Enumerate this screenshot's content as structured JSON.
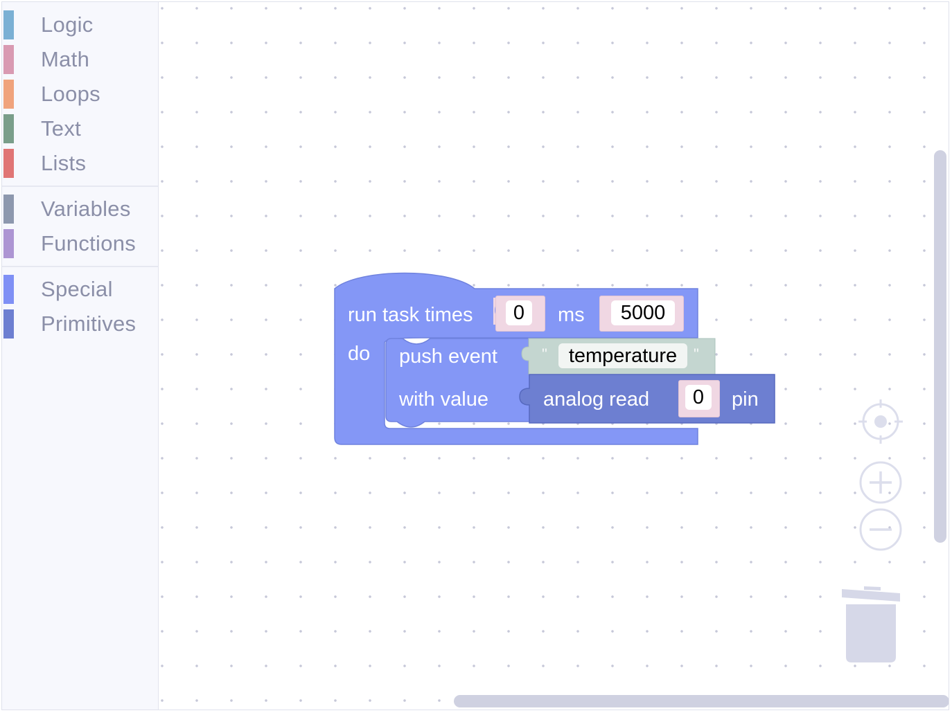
{
  "toolbox": {
    "groups": [
      [
        {
          "label": "Logic",
          "color": "#7bb0d4"
        },
        {
          "label": "Math",
          "color": "#d99ab2"
        },
        {
          "label": "Loops",
          "color": "#f0a37c"
        },
        {
          "label": "Text",
          "color": "#7a9e8a"
        },
        {
          "label": "Lists",
          "color": "#e07575"
        }
      ],
      [
        {
          "label": "Variables",
          "color": "#8d98ae"
        },
        {
          "label": "Functions",
          "color": "#ad95d3"
        }
      ],
      [
        {
          "label": "Special",
          "color": "#7f90f5"
        },
        {
          "label": "Primitives",
          "color": "#6d7fd1"
        }
      ]
    ]
  },
  "block": {
    "run_task_label": "run task times",
    "first_value": "0",
    "ms_label": "ms",
    "second_value": "5000",
    "do_label": "do",
    "push_event_label": "push event",
    "with_value_label": "with value",
    "quote_open": "\"",
    "event_name": "temperature",
    "quote_close": "\"",
    "analog_read_label": "analog read",
    "pin_value": "0",
    "pin_label": "pin",
    "colors": {
      "run_task": "#8497f6",
      "push_event": "#8497f6",
      "text": "#c4d6d0",
      "analog_read": "#6d7fd1",
      "number_field": "#f0d7e3"
    }
  },
  "controls": {
    "recenter_icon": "crosshair-icon",
    "zoom_in_icon": "plus-icon",
    "zoom_out_icon": "minus-icon",
    "trash_icon": "trash-icon"
  }
}
